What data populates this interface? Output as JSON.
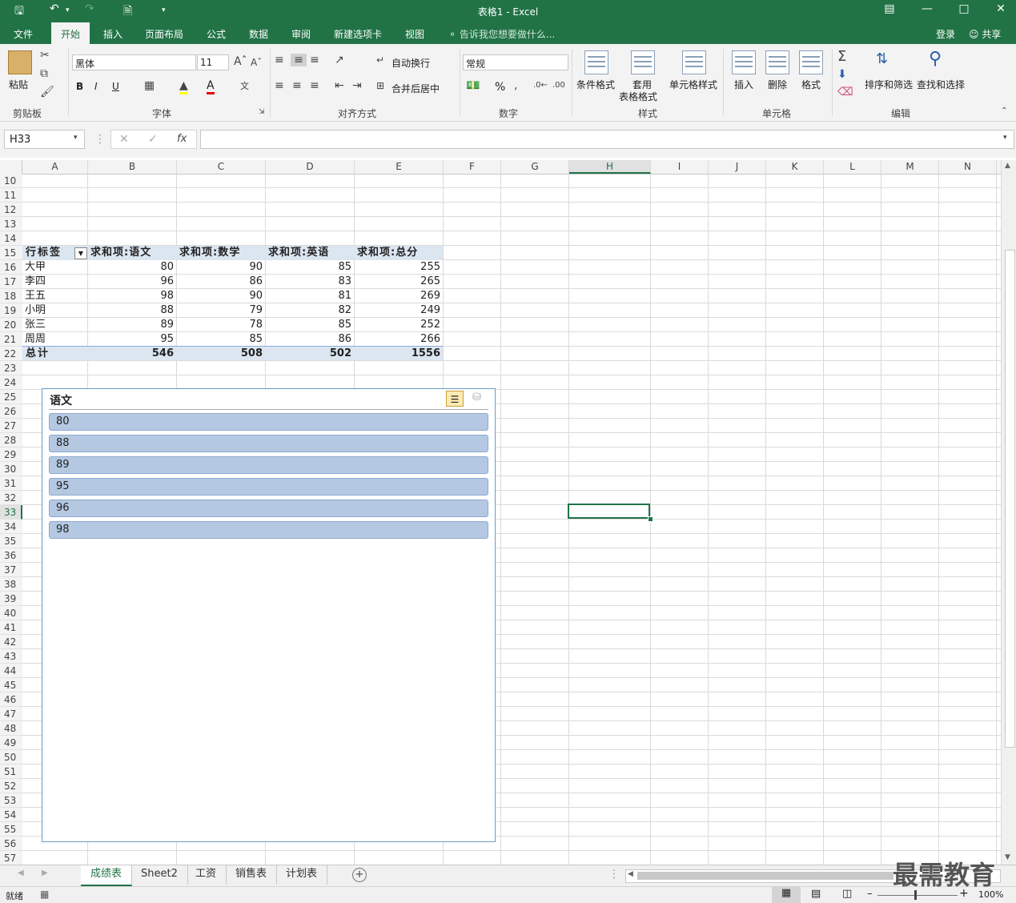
{
  "window": {
    "title": "表格1 - Excel"
  },
  "tabs": {
    "file": "文件",
    "home": "开始",
    "insert": "插入",
    "layout": "页面布局",
    "formulas": "公式",
    "data": "数据",
    "review": "审阅",
    "newtab": "新建选项卡",
    "view": "视图",
    "tellme": "告诉我您想要做什么...",
    "signin": "登录",
    "share": "共享"
  },
  "ribbon": {
    "clipboard": {
      "paste": "粘贴",
      "label": "剪贴板"
    },
    "font": {
      "name": "黑体",
      "size": "11",
      "label": "字体",
      "bold": "B",
      "italic": "I",
      "underline": "U"
    },
    "align": {
      "wrap": "自动换行",
      "merge": "合并后居中",
      "label": "对齐方式"
    },
    "number": {
      "format": "常规",
      "percent": "%",
      "label": "数字"
    },
    "styles": {
      "cond": "条件格式",
      "table_line1": "套用",
      "table_line2": "表格格式",
      "cellstyle": "单元格样式",
      "label": "样式"
    },
    "cells": {
      "insert": "插入",
      "delete": "删除",
      "format": "格式",
      "label": "单元格"
    },
    "edit": {
      "sortfilter": "排序和筛选",
      "findselect": "查找和选择",
      "label": "编辑"
    }
  },
  "formula": {
    "namebox": "H33",
    "fx": "fx",
    "value": ""
  },
  "columns": [
    "A",
    "B",
    "C",
    "D",
    "E",
    "F",
    "G",
    "H",
    "I",
    "J",
    "K",
    "L",
    "M",
    "N"
  ],
  "rows": [
    "10",
    "11",
    "12",
    "13",
    "14",
    "15",
    "16",
    "17",
    "18",
    "19",
    "20",
    "21",
    "22",
    "23",
    "24",
    "25",
    "26",
    "27",
    "28",
    "29",
    "30",
    "31",
    "32",
    "33",
    "34",
    "35",
    "36",
    "37",
    "38",
    "39",
    "40",
    "41",
    "42",
    "43",
    "44",
    "45",
    "46",
    "47",
    "48",
    "49",
    "50",
    "51",
    "52",
    "53",
    "54",
    "55",
    "56",
    "57"
  ],
  "pivot": {
    "headers": [
      "行标签",
      "求和项:语文",
      "求和项:数学",
      "求和项:英语",
      "求和项:总分"
    ],
    "rows": [
      {
        "name": "大甲",
        "values": [
          "80",
          "90",
          "85",
          "255"
        ]
      },
      {
        "name": "李四",
        "values": [
          "96",
          "86",
          "83",
          "265"
        ]
      },
      {
        "name": "王五",
        "values": [
          "98",
          "90",
          "81",
          "269"
        ]
      },
      {
        "name": "小明",
        "values": [
          "88",
          "79",
          "82",
          "249"
        ]
      },
      {
        "name": "张三",
        "values": [
          "89",
          "78",
          "85",
          "252"
        ]
      },
      {
        "name": "周周",
        "values": [
          "95",
          "85",
          "86",
          "266"
        ]
      }
    ],
    "total": {
      "name": "总计",
      "values": [
        "546",
        "508",
        "502",
        "1556"
      ]
    }
  },
  "slicer": {
    "title": "语文",
    "items": [
      "80",
      "88",
      "89",
      "95",
      "96",
      "98"
    ]
  },
  "sheets": [
    "成绩表",
    "Sheet2",
    "工资",
    "销售表",
    "计划表"
  ],
  "status": {
    "ready": "就绪",
    "zoom": "100%"
  },
  "watermark": "最需教育",
  "colors": {
    "accent": "#217346",
    "pivot_header": "#dce6f1",
    "slicer_item": "#b4c8e2"
  }
}
